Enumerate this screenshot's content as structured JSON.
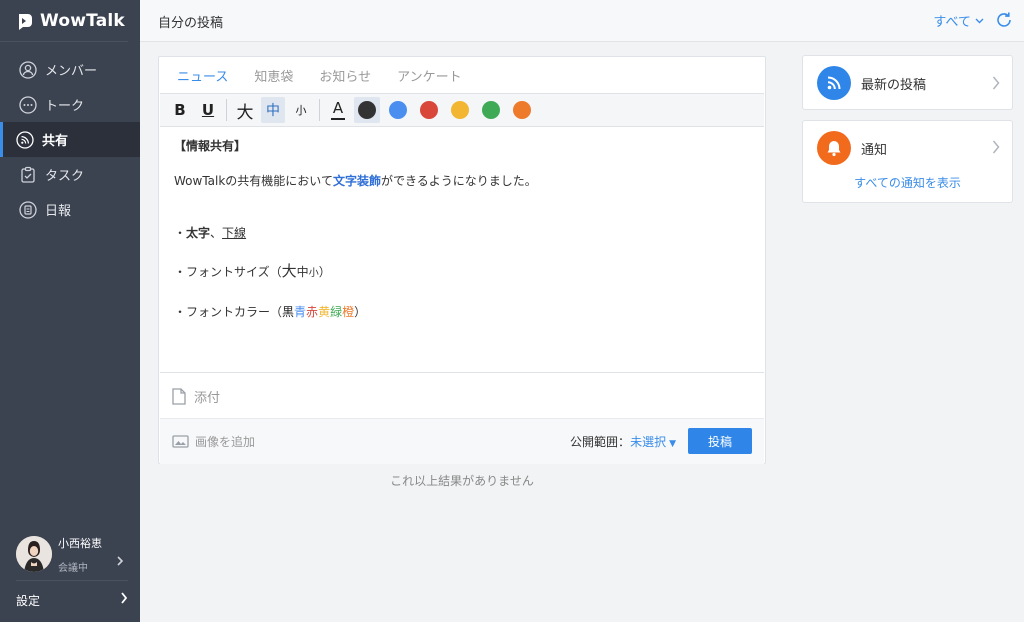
{
  "app": {
    "name": "WowTalk"
  },
  "sidebar": {
    "items": [
      {
        "label": "メンバー",
        "icon": "person-icon"
      },
      {
        "label": "トーク",
        "icon": "chat-icon"
      },
      {
        "label": "共有",
        "icon": "feed-icon",
        "active": true
      },
      {
        "label": "タスク",
        "icon": "clipboard-icon"
      },
      {
        "label": "日報",
        "icon": "report-icon"
      }
    ],
    "profile": {
      "name": "小西裕恵",
      "status": "会議中"
    },
    "settings_label": "設定"
  },
  "header": {
    "title": "自分の投稿",
    "filter_label": "すべて"
  },
  "editor": {
    "tabs": [
      {
        "label": "ニュース",
        "active": true
      },
      {
        "label": "知恵袋"
      },
      {
        "label": "お知らせ"
      },
      {
        "label": "アンケート"
      }
    ],
    "toolbar": {
      "bold": "B",
      "underline": "U",
      "size_large": "大",
      "size_medium": "中",
      "size_small": "小",
      "font_color": "A"
    },
    "colors": [
      "#333333",
      "#4a8ef0",
      "#d9473b",
      "#f2b632",
      "#3faa55",
      "#ee7a2c"
    ],
    "content": {
      "heading": "【情報共有】",
      "line1_pre": "WowTalkの共有機能において",
      "line1_emph": "文字装飾",
      "line1_post": "ができるようになりました。",
      "bullet1_pre": "・",
      "bullet1_bold": "太字",
      "bullet1_sep": "、",
      "bullet1_underline": "下線",
      "bullet2_pre": "・フォントサイズ（",
      "bullet2_large": "大",
      "bullet2_medium": "中",
      "bullet2_small": "小",
      "bullet2_post": "）",
      "bullet3_pre": "・フォントカラー（",
      "bullet3_black": "黒",
      "bullet3_blue": "青",
      "bullet3_red": "赤",
      "bullet3_yellow": "黄",
      "bullet3_green": "緑",
      "bullet3_orange": "橙",
      "bullet3_post": "）"
    },
    "attach_label": "添付",
    "add_image_label": "画像を追加",
    "scope_label": "公開範囲：",
    "scope_value": "未選択",
    "post_button": "投稿"
  },
  "no_more_results": "これ以上結果がありません",
  "widgets": {
    "latest": {
      "label": "最新の投稿",
      "color": "#2f86e8"
    },
    "notifications": {
      "label": "通知",
      "link": "すべての通知を表示",
      "color": "#f26a1b"
    }
  }
}
